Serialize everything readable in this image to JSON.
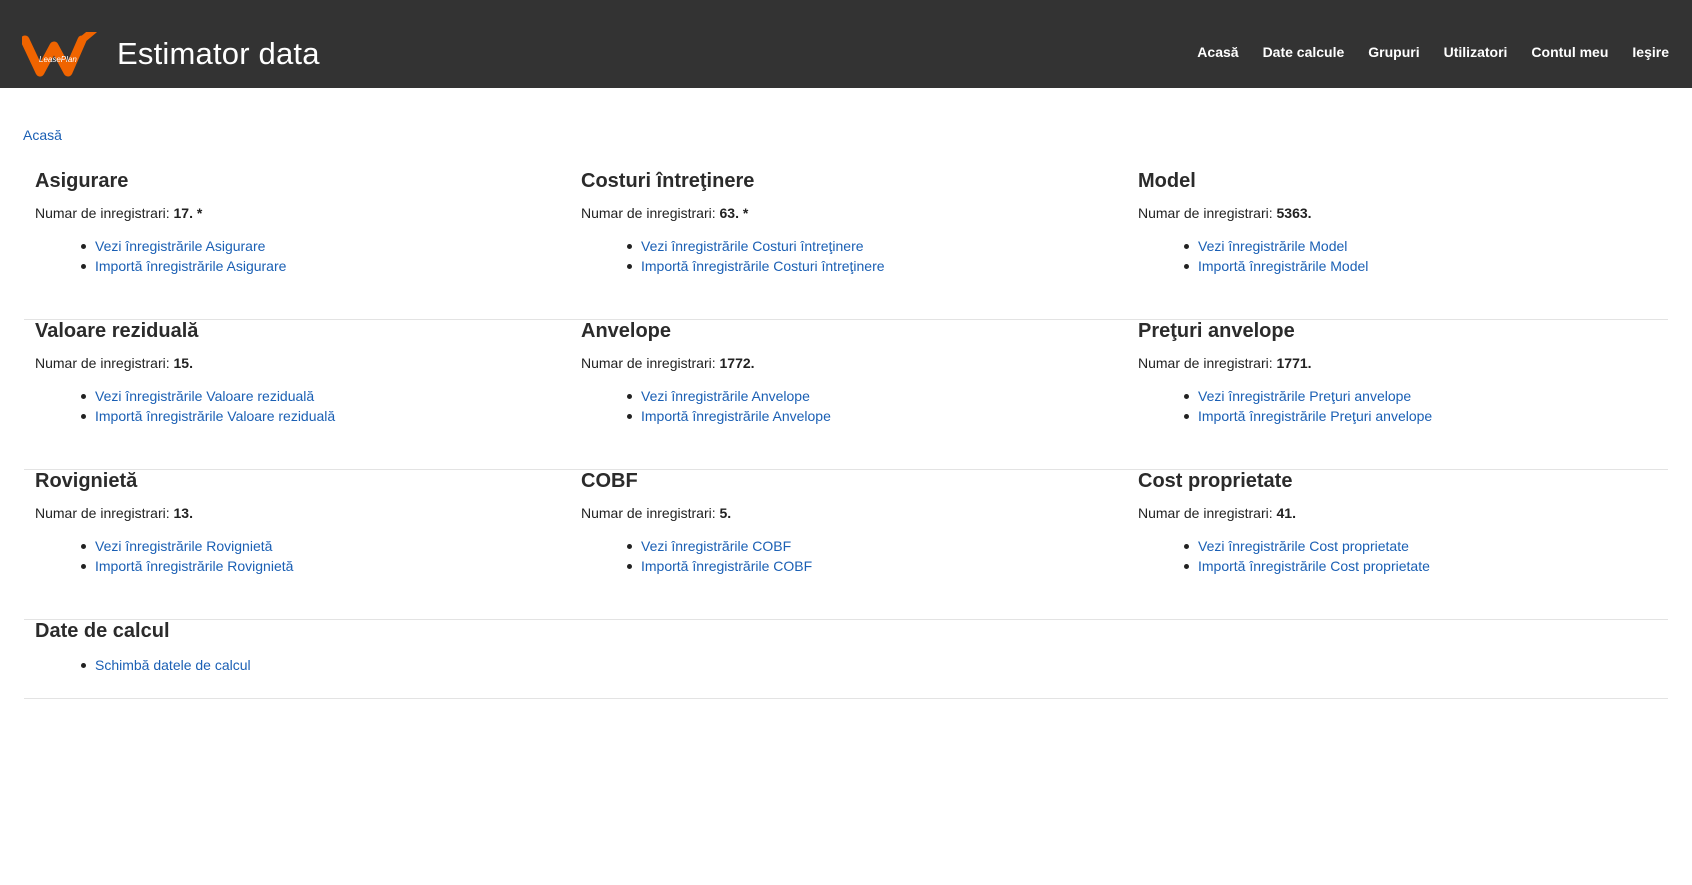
{
  "header": {
    "logo_text": "LeasePlan",
    "title": "Estimator data",
    "nav": [
      "Acasă",
      "Date calcule",
      "Grupuri",
      "Utilizatori",
      "Contul meu",
      "Ieşire"
    ]
  },
  "breadcrumb": "Acasă",
  "count_label": "Numar de inregistrari:",
  "sections": [
    {
      "title": "Asigurare",
      "count": "17. *",
      "view": "Vezi înregistrările Asigurare",
      "import": "Importă înregistrările Asigurare"
    },
    {
      "title": "Costuri întreţinere",
      "count": "63. *",
      "view": "Vezi înregistrările Costuri întreţinere",
      "import": "Importă înregistrările Costuri întreţinere"
    },
    {
      "title": "Model",
      "count": "5363.",
      "view": "Vezi înregistrările Model",
      "import": "Importă înregistrările Model"
    },
    {
      "title": "Valoare reziduală",
      "count": "15.",
      "view": "Vezi înregistrările Valoare reziduală",
      "import": "Importă înregistrările Valoare reziduală"
    },
    {
      "title": "Anvelope",
      "count": "1772.",
      "view": "Vezi înregistrările Anvelope",
      "import": "Importă înregistrările Anvelope"
    },
    {
      "title": "Preţuri anvelope",
      "count": "1771.",
      "view": "Vezi înregistrările Preţuri anvelope",
      "import": "Importă înregistrările Preţuri anvelope"
    },
    {
      "title": "Rovignietă",
      "count": "13.",
      "view": "Vezi înregistrările Rovignietă",
      "import": "Importă înregistrările Rovignietă"
    },
    {
      "title": "COBF",
      "count": "5.",
      "view": "Vezi înregistrările COBF",
      "import": "Importă înregistrările COBF"
    },
    {
      "title": "Cost proprietate",
      "count": "41.",
      "view": "Vezi înregistrările Cost proprietate",
      "import": "Importă înregistrările Cost proprietate"
    }
  ],
  "calc": {
    "title": "Date de calcul",
    "link": "Schimbă datele de calcul"
  },
  "colors": {
    "header_bg": "#333333",
    "link": "#1a5fb4",
    "logo_orange": "#f06400"
  }
}
